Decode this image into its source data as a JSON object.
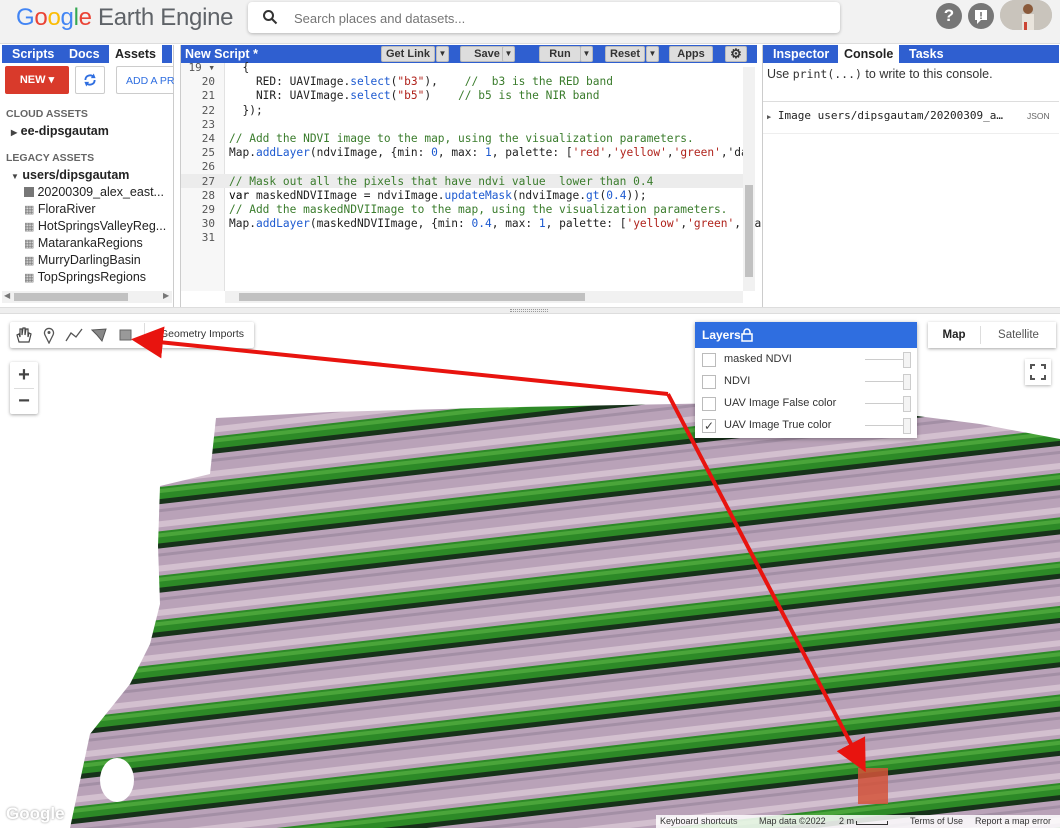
{
  "header": {
    "logo_google": "Google",
    "logo_product": " Earth Engine",
    "search_placeholder": "Search places and datasets..."
  },
  "left_panel": {
    "tabs": [
      "Scripts",
      "Docs",
      "Assets"
    ],
    "new_button": "NEW",
    "add_project_button": "ADD A PR",
    "cloud_assets_heading": "CLOUD ASSETS",
    "cloud_root": "ee-dipsgautam",
    "legacy_assets_heading": "LEGACY ASSETS",
    "legacy_root": "users/dipsgautam",
    "legacy_items": [
      "20200309_alex_east...",
      "FloraRiver",
      "HotSpringsValleyReg...",
      "MatarankaRegions",
      "MurryDarlingBasin",
      "TopSpringsRegions"
    ]
  },
  "editor": {
    "title": "New Script *",
    "buttons": {
      "get_link": "Get Link",
      "save": "Save",
      "run": "Run",
      "reset": "Reset",
      "apps": "Apps"
    },
    "line_numbers": [
      "19 ▾",
      "20",
      "21",
      "22",
      "23",
      "24",
      "25",
      "26",
      "27",
      "28",
      "29",
      "30",
      "31"
    ],
    "lines": [
      "  {",
      "    RED: UAVImage.select(\"b3\"),    //  b3 is the RED band",
      "    NIR: UAVImage.select(\"b5\")    // b5 is the NIR band",
      "  });",
      "",
      "// Add the NDVI image to the map, using the visualization parameters.",
      "Map.addLayer(ndviImage, {min: 0, max: 1, palette: ['red','yellow','green','dar",
      "",
      "// Mask out all the pixels that have ndvi value  lower than 0.4",
      "var maskedNDVIImage = ndviImage.updateMask(ndviImage.gt(0.4));",
      "// Add the maskedNDVIImage to the map, using the visualization parameters.",
      "Map.addLayer(maskedNDVIImage, {min: 0.4, max: 1, palette: ['yellow','green','da",
      ""
    ]
  },
  "console": {
    "tabs": [
      "Inspector",
      "Console",
      "Tasks"
    ],
    "hint_prefix": "Use ",
    "hint_code": "print(...)",
    "hint_suffix": " to write to this console.",
    "entry_text": "Image users/dipsgautam/20200309_a…",
    "entry_badge": "JSON"
  },
  "map": {
    "geometry_imports": "Geometry Imports",
    "zoom_in": "+",
    "zoom_out": "−",
    "layers_title": "Layers",
    "layers": [
      {
        "name": "masked NDVI",
        "checked": false
      },
      {
        "name": "NDVI",
        "checked": false
      },
      {
        "name": "UAV Image False color",
        "checked": false
      },
      {
        "name": "UAV Image True color",
        "checked": true
      }
    ],
    "map_type_map": "Map",
    "map_type_satellite": "Satellite",
    "footer": {
      "keyboard": "Keyboard shortcuts",
      "map_data": "Map data ©2022",
      "scale": "2 m",
      "terms": "Terms of Use",
      "report": "Report a map error"
    },
    "google_watermark": "Google"
  },
  "colors": {
    "tab_blue": "#2f5fd0",
    "layers_blue": "#2f6ee0",
    "new_red": "#d93a2b",
    "arrow_red": "#e8140f",
    "crop_green": "#2f8a2a",
    "soil_pink": "#c7aec4"
  }
}
